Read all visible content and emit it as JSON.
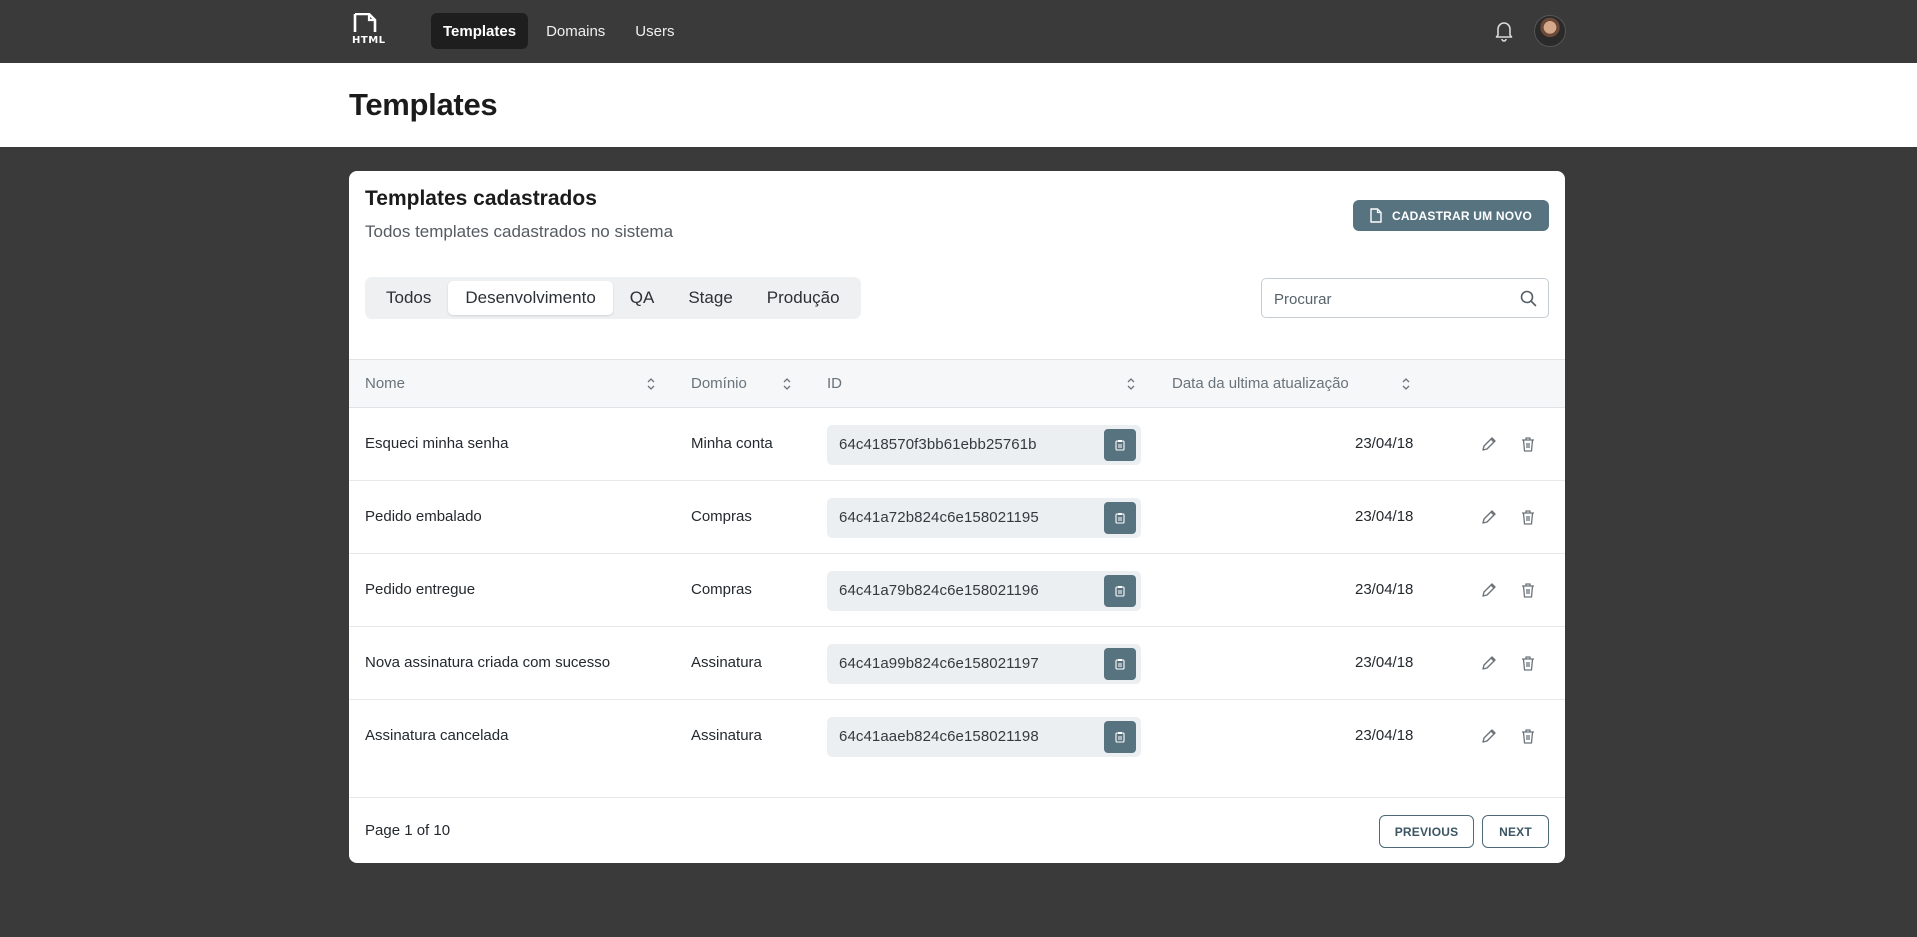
{
  "nav": {
    "logo_text": "HTML",
    "items": [
      {
        "label": "Templates",
        "active": true
      },
      {
        "label": "Domains",
        "active": false
      },
      {
        "label": "Users",
        "active": false
      }
    ],
    "icons": {
      "bell": "bell-icon",
      "avatar": "user-avatar"
    }
  },
  "header": {
    "title": "Templates"
  },
  "card": {
    "title": "Templates cadastrados",
    "subtitle": "Todos templates cadastrados no sistema",
    "new_button_label": "CADASTRAR UM NOVO",
    "tabs": [
      {
        "label": "Todos",
        "active": false
      },
      {
        "label": "Desenvolvimento",
        "active": true
      },
      {
        "label": "QA",
        "active": false
      },
      {
        "label": "Stage",
        "active": false
      },
      {
        "label": "Produção",
        "active": false
      }
    ],
    "search": {
      "placeholder": "Procurar",
      "value": ""
    }
  },
  "table": {
    "columns": {
      "name": "Nome",
      "domain": "Domínio",
      "id": "ID",
      "updated": "Data da ultima atualização"
    },
    "rows": [
      {
        "name": "Esqueci minha senha",
        "domain": "Minha conta",
        "id": "64c418570f3bb61ebb25761b",
        "updated": "23/04/18"
      },
      {
        "name": "Pedido embalado",
        "domain": "Compras",
        "id": "64c41a72b824c6e158021195",
        "updated": "23/04/18"
      },
      {
        "name": "Pedido entregue",
        "domain": "Compras",
        "id": "64c41a79b824c6e158021196",
        "updated": "23/04/18"
      },
      {
        "name": "Nova assinatura criada com sucesso",
        "domain": "Assinatura",
        "id": "64c41a99b824c6e158021197",
        "updated": "23/04/18"
      },
      {
        "name": "Assinatura cancelada",
        "domain": "Assinatura",
        "id": "64c41aaeb824c6e158021198",
        "updated": "23/04/18"
      }
    ]
  },
  "pagination": {
    "info": "Page 1 of 10",
    "previous_label": "PREVIOUS",
    "next_label": "NEXT"
  },
  "colors": {
    "background": "#3a3a3a",
    "accent": "#587380",
    "nav_active": "#1e1e1e"
  }
}
